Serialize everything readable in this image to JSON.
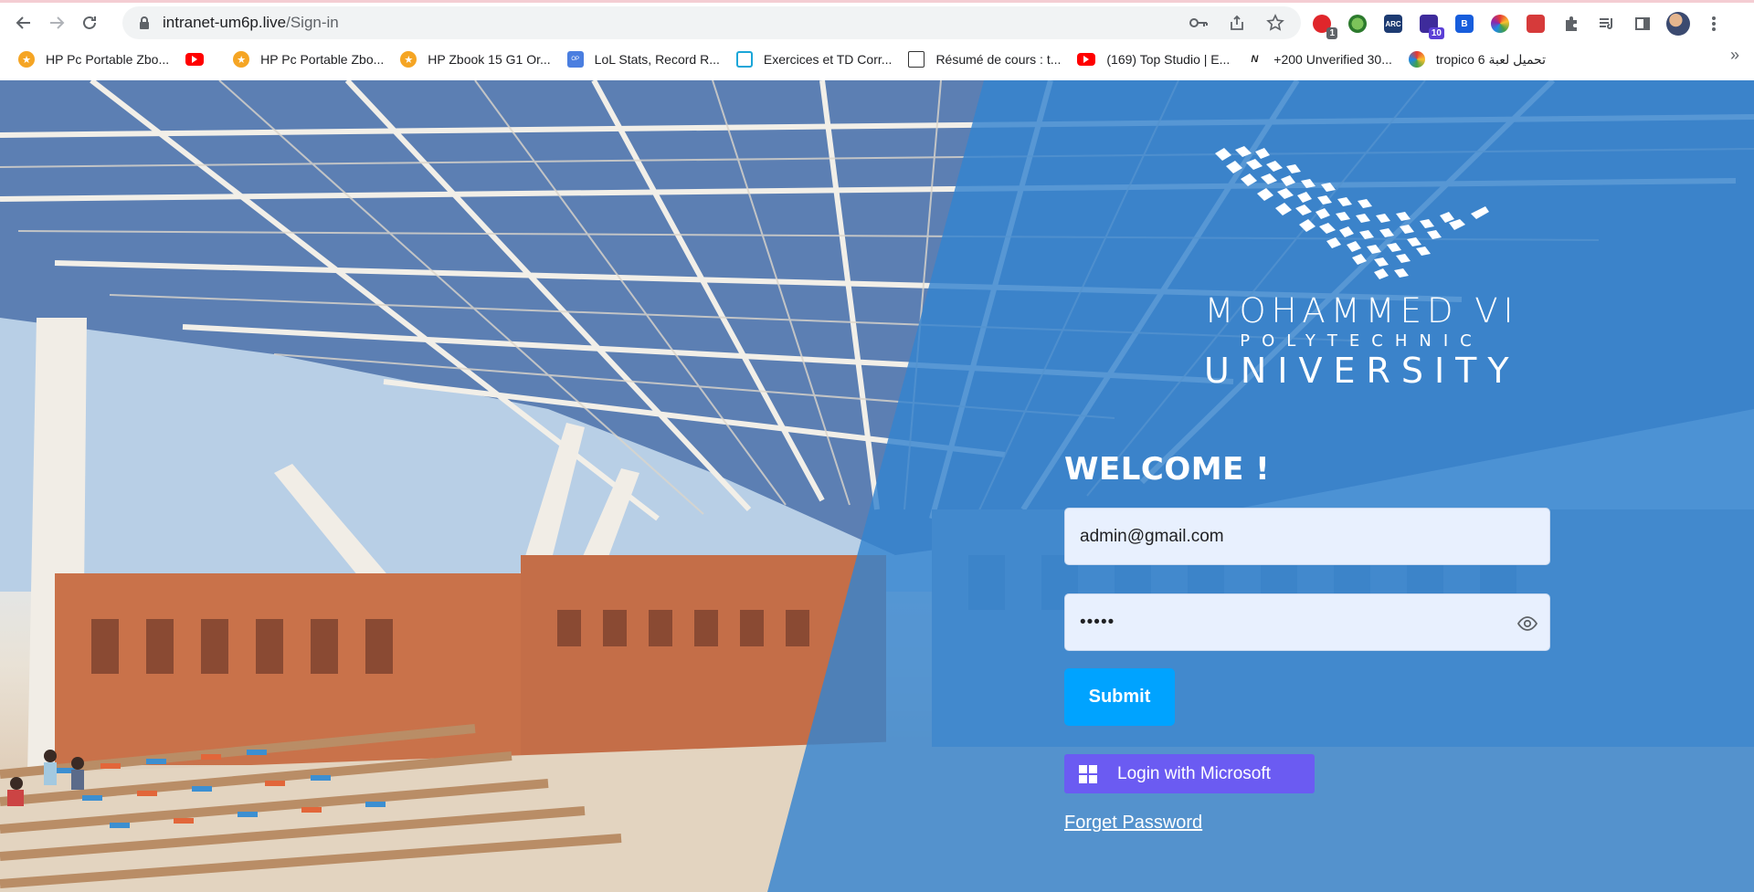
{
  "browser": {
    "url_host": "intranet-um6p.live",
    "url_path": "/Sign-in",
    "extension_badges": {
      "first": "1",
      "graduation": "10"
    },
    "bookmarks": [
      {
        "label": "HP Pc Portable Zbo...",
        "icon": "star-favicon"
      },
      {
        "label": "",
        "icon": "youtube-favicon"
      },
      {
        "label": "HP Pc Portable Zbo...",
        "icon": "star-favicon"
      },
      {
        "label": "HP Zbook 15 G1 Or...",
        "icon": "star-favicon"
      },
      {
        "label": "LoL Stats, Record R...",
        "icon": "opgg-favicon"
      },
      {
        "label": "Exercices et TD Corr...",
        "icon": "exercise-favicon"
      },
      {
        "label": "Résumé de cours : t...",
        "icon": "book-favicon"
      },
      {
        "label": "(169) Top Studio | E...",
        "icon": "youtube-favicon"
      },
      {
        "label": "+200 Unverified 30...",
        "icon": "bolt-favicon"
      },
      {
        "label": "tropico 6 تحميل لعبة",
        "icon": "rainbow-favicon"
      }
    ],
    "more_bookmarks": "»"
  },
  "logo": {
    "line1": "MOHAMMED VI",
    "line2": "POLYTECHNIC",
    "line3": "UNIVERSITY"
  },
  "login": {
    "welcome": "WELCOME !",
    "email_value": "admin@gmail.com",
    "password_mask": "•••••",
    "submit_label": "Submit",
    "microsoft_label": "Login with Microsoft",
    "forget_label": "Forget Password"
  },
  "colors": {
    "overlay": "#3484cf",
    "submit": "#00a3ff",
    "microsoft": "#6b5bf2",
    "input_bg": "#e8f0fe"
  }
}
